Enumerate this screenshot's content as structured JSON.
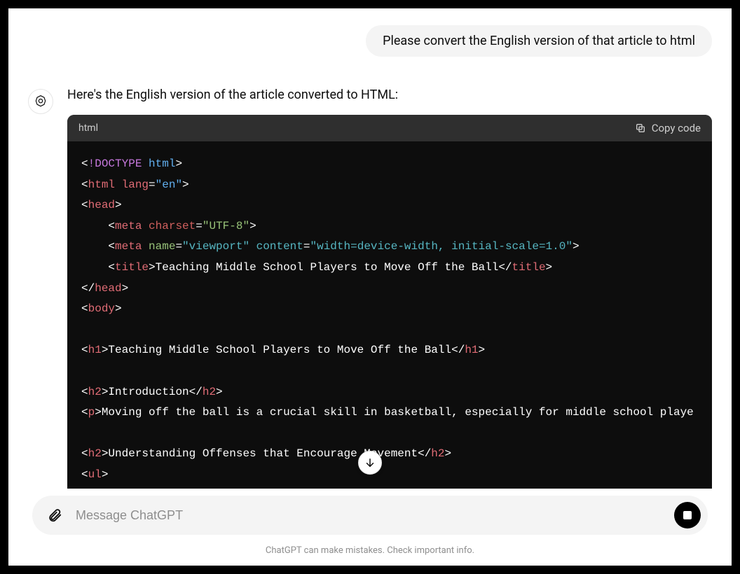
{
  "user_message": "Please convert the English version of that article to html",
  "assistant_intro": "Here's the English version of the article converted to HTML:",
  "code": {
    "lang_label": "html",
    "copy_label": "Copy code",
    "lines": {
      "l1_doctype": "!DOCTYPE",
      "l1_html": "html",
      "l2_html": "html",
      "l2_lang": "lang",
      "l2_en": "\"en\"",
      "l3_head": "head",
      "l4_meta": "meta",
      "l4_charset_attr": "charset",
      "l4_charset_val": "\"UTF-8\"",
      "l5_meta": "meta",
      "l5_name_attr": "name",
      "l5_name_val": "\"viewport\"",
      "l5_content_attr": "content",
      "l5_content_val": "\"width=device-width, initial-scale=1.0\"",
      "l6_title_open": "title",
      "l6_title_text": "Teaching Middle School Players to Move Off the Ball",
      "l6_title_close": "title",
      "l7_head_close": "head",
      "l8_body": "body",
      "l9_h1": "h1",
      "l9_h1_text": "Teaching Middle School Players to Move Off the Ball",
      "l9_h1_close": "h1",
      "l10_h2": "h2",
      "l10_h2_text": "Introduction",
      "l10_h2_close": "h2",
      "l11_p": "p",
      "l11_p_text": "Moving off the ball is a crucial skill in basketball, especially for middle school playe",
      "l12_h2": "h2",
      "l12_h2_text": "Understanding Offenses that Encourage Movement",
      "l12_h2_close": "h2",
      "l13_ul": "ul"
    }
  },
  "composer": {
    "placeholder": "Message ChatGPT"
  },
  "footer": "ChatGPT can make mistakes. Check important info."
}
